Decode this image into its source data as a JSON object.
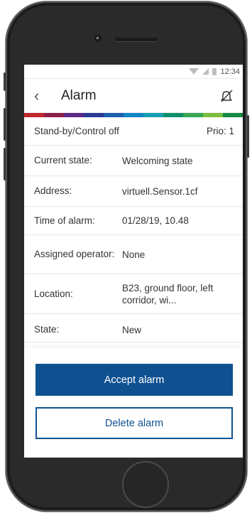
{
  "status_bar": {
    "time": "12:34",
    "icons": [
      "wifi-icon",
      "signal-icon",
      "battery-icon"
    ]
  },
  "header": {
    "back_icon": "chevron-left-icon",
    "title": "Alarm",
    "action_icon": "mute-icon"
  },
  "color_strip": [
    "#c0262d",
    "#8b1f4a",
    "#5b2a86",
    "#2d3a94",
    "#1d5fae",
    "#0f86c6",
    "#17a0b3",
    "#0e8f6d",
    "#36a852",
    "#7bbd3c",
    "#138a43"
  ],
  "alarm_header": {
    "state_label": "Stand-by/Control off",
    "priority": "Prio: 1"
  },
  "details": [
    {
      "label": "Current state:",
      "value": "Welcoming state"
    },
    {
      "label": "Address:",
      "value": "virtuell.Sensor.1cf"
    },
    {
      "label": "Time of alarm:",
      "value": "01/28/19, 10.48"
    },
    {
      "label": "Assigned operator:",
      "value": "None"
    },
    {
      "label": "Location:",
      "value": "B23, ground floor, left corridor, wi..."
    },
    {
      "label": "State:",
      "value": "New"
    }
  ],
  "actions": {
    "accept_label": "Accept alarm",
    "delete_label": "Delete alarm"
  },
  "colors": {
    "primary": "#0f5190",
    "background": "#ffffff",
    "device": "#2a2a2a"
  }
}
